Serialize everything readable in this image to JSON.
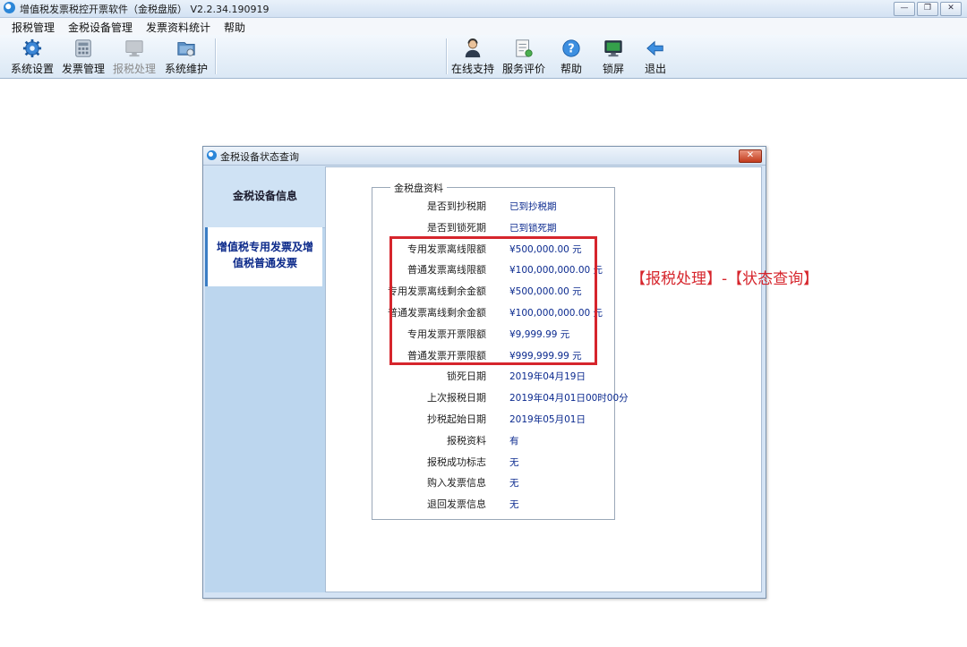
{
  "window": {
    "title": "增值税发票税控开票软件（金税盘版） V2.2.34.190919",
    "controls": {
      "minimize": "—",
      "restore": "❐",
      "close": "✕"
    }
  },
  "menubar": {
    "items": [
      {
        "label": "报税管理"
      },
      {
        "label": "金税设备管理"
      },
      {
        "label": "发票资料统计"
      },
      {
        "label": "帮助"
      }
    ]
  },
  "toolbar": {
    "left": [
      {
        "label": "系统设置",
        "icon": "gear-icon",
        "enabled": true
      },
      {
        "label": "发票管理",
        "icon": "invoice-calculator-icon",
        "enabled": true
      },
      {
        "label": "报税处理",
        "icon": "monitor-icon",
        "enabled": false
      },
      {
        "label": "系统维护",
        "icon": "maintenance-folder-icon",
        "enabled": true
      }
    ],
    "right": [
      {
        "label": "在线支持",
        "icon": "support-person-icon"
      },
      {
        "label": "服务评价",
        "icon": "document-rating-icon"
      },
      {
        "label": "帮助",
        "icon": "help-question-icon"
      },
      {
        "label": "锁屏",
        "icon": "lock-screen-icon"
      },
      {
        "label": "退出",
        "icon": "exit-arrow-icon"
      }
    ]
  },
  "dialog": {
    "title": "金税设备状态查询",
    "close": "✕",
    "nav": [
      {
        "label": "金税设备信息"
      },
      {
        "label": "增值税专用发票及增值税普通发票",
        "line1": "增值税专用发票及增",
        "line2": "值税普通发票",
        "active": true
      }
    ],
    "group_title": "金税盘资料",
    "rows": [
      {
        "label": "是否到抄税期",
        "value": "已到抄税期"
      },
      {
        "label": "是否到锁死期",
        "value": "已到锁死期"
      },
      {
        "label": "专用发票离线限额",
        "value": "¥500,000.00 元"
      },
      {
        "label": "普通发票离线限额",
        "value": "¥100,000,000.00 元"
      },
      {
        "label": "专用发票离线剩余金额",
        "value": "¥500,000.00 元"
      },
      {
        "label": "普通发票离线剩余金额",
        "value": "¥100,000,000.00 元"
      },
      {
        "label": "专用发票开票限额",
        "value": "¥9,999.99 元"
      },
      {
        "label": "普通发票开票限额",
        "value": "¥999,999.99 元"
      },
      {
        "label": "锁死日期",
        "value": "2019年04月19日"
      },
      {
        "label": "上次报税日期",
        "value": "2019年04月01日00时00分"
      },
      {
        "label": "抄税起始日期",
        "value": "2019年05月01日"
      },
      {
        "label": "报税资料",
        "value": "有"
      },
      {
        "label": "报税成功标志",
        "value": "无"
      },
      {
        "label": "购入发票信息",
        "value": "无"
      },
      {
        "label": "退回发票信息",
        "value": "无"
      }
    ]
  },
  "annotation": {
    "text": "【报税处理】-【状态查询】",
    "color": "#d6252c"
  },
  "colors": {
    "accent": "#3a7dc4",
    "highlight": "#d6252c",
    "value_text": "#0b2a8f"
  }
}
